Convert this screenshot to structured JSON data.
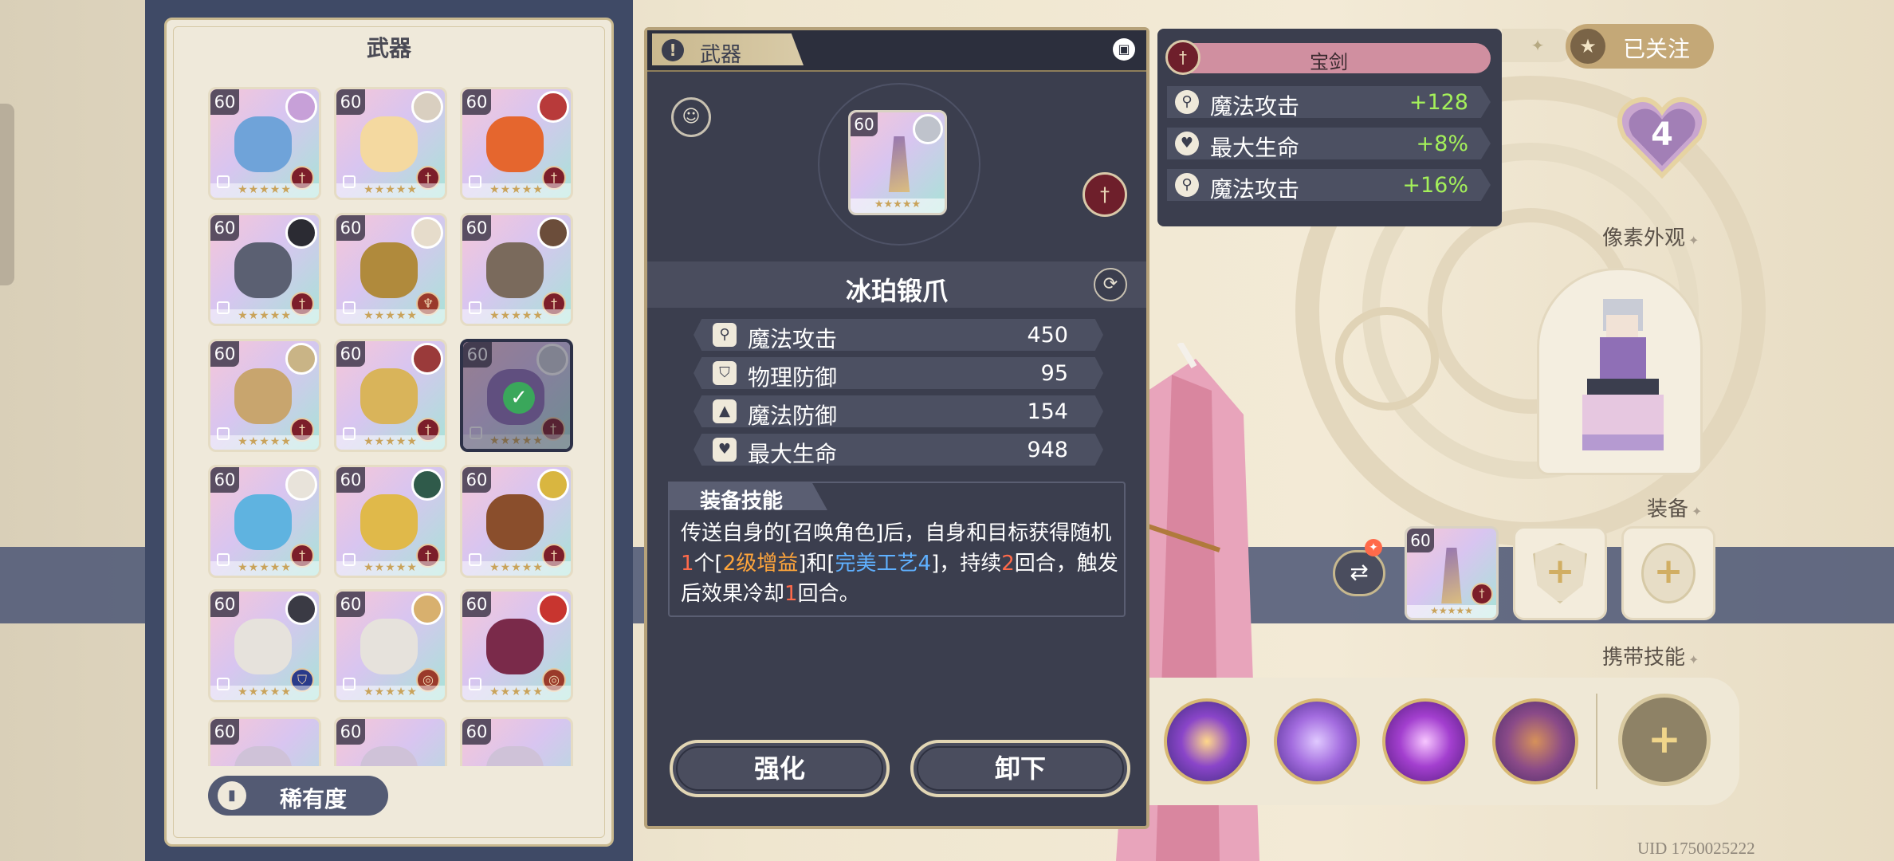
{
  "weapon_list": {
    "title": "武器",
    "rarity_label": "稀有度",
    "items": [
      {
        "level": "60",
        "stars": "★★★★★",
        "type": "sword",
        "art": "#6fa3d9",
        "avatar": "#c7a0d8",
        "selected": false
      },
      {
        "level": "60",
        "stars": "★★★★★",
        "type": "sword",
        "art": "#f4d9a0",
        "avatar": "#d9cfc0",
        "selected": false
      },
      {
        "level": "60",
        "stars": "★★★★★",
        "type": "sword",
        "art": "#e5662e",
        "avatar": "#b83a3a",
        "selected": false
      },
      {
        "level": "60",
        "stars": "★★★★★",
        "type": "sword",
        "art": "#5b6072",
        "avatar": "#2b2b33",
        "selected": false
      },
      {
        "level": "60",
        "stars": "★★★★★",
        "type": "staff",
        "art": "#b08a3c",
        "avatar": "#e6dccb",
        "selected": false
      },
      {
        "level": "60",
        "stars": "★★★★★",
        "type": "sword",
        "art": "#7a6a5c",
        "avatar": "#6b4d3a",
        "selected": false
      },
      {
        "level": "60",
        "stars": "★★★★★",
        "type": "sword",
        "art": "#c8a56e",
        "avatar": "#c9b486",
        "selected": false
      },
      {
        "level": "60",
        "stars": "★★★★★",
        "type": "sword",
        "art": "#d9b45a",
        "avatar": "#9a3a3a",
        "selected": false
      },
      {
        "level": "60",
        "stars": "★★★★★",
        "type": "sword",
        "art": "#8f6fb6",
        "avatar": "#c9ccd6",
        "selected": true
      },
      {
        "level": "60",
        "stars": "★★★★★",
        "type": "sword",
        "art": "#5fb3e0",
        "avatar": "#e8e3da",
        "selected": false
      },
      {
        "level": "60",
        "stars": "★★★★★",
        "type": "sword",
        "art": "#e0b94a",
        "avatar": "#2f5a4a",
        "selected": false
      },
      {
        "level": "60",
        "stars": "★★★★★",
        "type": "sword",
        "art": "#8a4e2c",
        "avatar": "#d9b640",
        "selected": false
      },
      {
        "level": "60",
        "stars": "★★★★★",
        "type": "shield",
        "art": "#e6e2dc",
        "avatar": "#3a3a44",
        "selected": false
      },
      {
        "level": "60",
        "stars": "★★★★★",
        "type": "ring",
        "art": "#e6e2dc",
        "avatar": "#d8b06e",
        "selected": false
      },
      {
        "level": "60",
        "stars": "★★★★★",
        "type": "ring",
        "art": "#7a2a4a",
        "avatar": "#c8352f",
        "selected": false
      },
      {
        "level": "60",
        "stars": "",
        "type": "",
        "art": "#cfc2d8",
        "avatar": "",
        "selected": false
      },
      {
        "level": "60",
        "stars": "",
        "type": "",
        "art": "#cfc2d8",
        "avatar": "",
        "selected": false
      },
      {
        "level": "60",
        "stars": "",
        "type": "",
        "art": "#cfc2d8",
        "avatar": "",
        "selected": false
      }
    ]
  },
  "detail": {
    "header_title": "武器",
    "lock_icon": "lock-icon",
    "card_level": "60",
    "card_stars": "★★★★★",
    "weapon_name": "冰珀锻爪",
    "stats": [
      {
        "icon": "wand",
        "name": "魔法攻击",
        "value": "450"
      },
      {
        "icon": "shield",
        "name": "物理防御",
        "value": "95"
      },
      {
        "icon": "hat",
        "name": "魔法防御",
        "value": "154"
      },
      {
        "icon": "heart",
        "name": "最大生命",
        "value": "948"
      }
    ],
    "skill_title": "装备技能",
    "skill_segments": [
      {
        "text": "传送自身的[召唤角色]后，自身和目标获得随机",
        "cls": ""
      },
      {
        "text": "1",
        "cls": "hl-red"
      },
      {
        "text": "个[",
        "cls": ""
      },
      {
        "text": "2级增益",
        "cls": "hl-orange"
      },
      {
        "text": "]和[",
        "cls": ""
      },
      {
        "text": "完美工艺4",
        "cls": "hl-blue"
      },
      {
        "text": "]，持续",
        "cls": ""
      },
      {
        "text": "2",
        "cls": "hl-red"
      },
      {
        "text": "回合，触发后效果冷却",
        "cls": ""
      },
      {
        "text": "1",
        "cls": "hl-red"
      },
      {
        "text": "回合。",
        "cls": ""
      }
    ],
    "enhance_label": "强化",
    "unequip_label": "卸下"
  },
  "bonus": {
    "header_label": "宝剑",
    "rows": [
      {
        "icon": "wand",
        "name": "魔法攻击",
        "value": "+128"
      },
      {
        "icon": "heart",
        "name": "最大生命",
        "value": "+8%"
      },
      {
        "icon": "wand",
        "name": "魔法攻击",
        "value": "+16%"
      }
    ]
  },
  "right": {
    "follow_label": "已关注",
    "heart_badge_value": "4",
    "pixel_title": "像素外观",
    "equip_title": "装备",
    "equip_level": "60",
    "equip_stars": "★★★★★",
    "skills_title": "携带技能",
    "uid": "UID 1750025222"
  },
  "colors": {
    "accent_gold": "#c4a877",
    "panel_dark": "#3b3e4e",
    "bonus_green": "#a4f05a",
    "highlight_red": "#ff6a4a",
    "highlight_orange": "#ffa53b",
    "highlight_blue": "#5fb0ff"
  }
}
